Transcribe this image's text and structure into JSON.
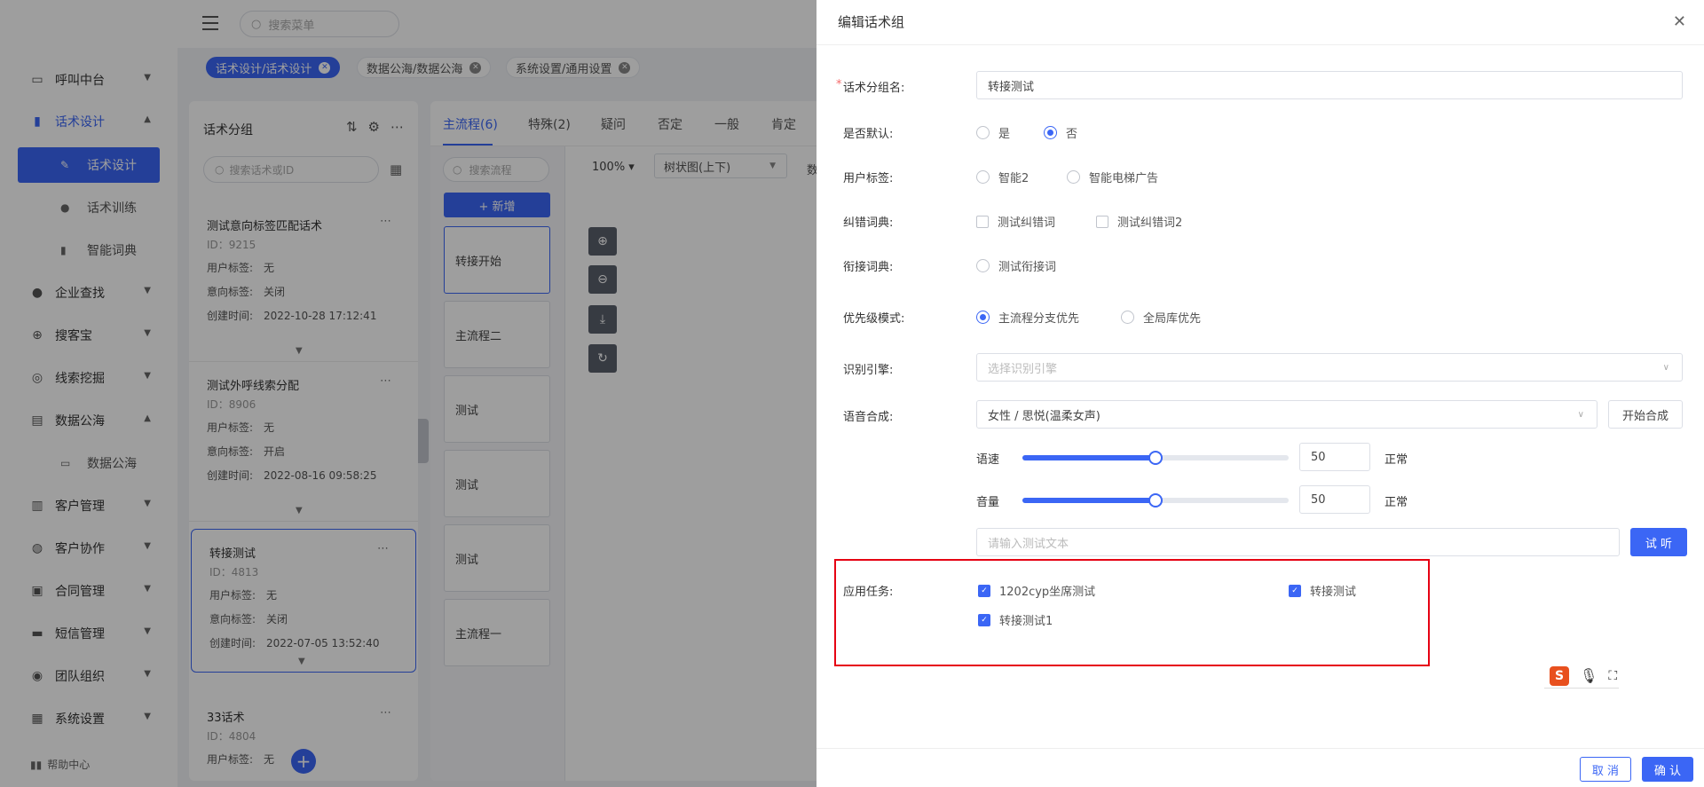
{
  "sidebar": {
    "items": [
      {
        "label": "呼叫中台",
        "icon": "monitor-icon"
      },
      {
        "label": "话术设计",
        "icon": "book-icon"
      },
      {
        "label": "企业查找",
        "icon": "bulb-icon"
      },
      {
        "label": "搜客宝",
        "icon": "search-plus-icon"
      },
      {
        "label": "线索挖掘",
        "icon": "target-icon"
      },
      {
        "label": "数据公海",
        "icon": "chart-icon"
      },
      {
        "label": "客户管理",
        "icon": "id-card-icon"
      },
      {
        "label": "客户协作",
        "icon": "globe-icon"
      },
      {
        "label": "合同管理",
        "icon": "clipboard-icon"
      },
      {
        "label": "短信管理",
        "icon": "message-icon"
      },
      {
        "label": "团队组织",
        "icon": "team-icon"
      },
      {
        "label": "系统设置",
        "icon": "grid-icon"
      }
    ],
    "sub_script": [
      "话术设计",
      "话术训练",
      "智能词典"
    ],
    "sub_data": [
      "数据公海"
    ],
    "help": "帮助中心"
  },
  "top": {
    "search_placeholder": "搜索菜单"
  },
  "tags": [
    {
      "label": "话术设计/话术设计"
    },
    {
      "label": "数据公海/数据公海"
    },
    {
      "label": "系统设置/通用设置"
    }
  ],
  "groups": {
    "title": "话术分组",
    "search_placeholder": "搜索话术或ID",
    "field_labels": {
      "user_tag": "用户标签:",
      "intent_tag": "意向标签:",
      "created": "创建时间:"
    },
    "cards": [
      {
        "name": "测试意向标签匹配话术",
        "id": "ID：9215",
        "user_tag": "无",
        "intent_tag": "关闭",
        "created": "2022-10-28 17:12:41"
      },
      {
        "name": "测试外呼线索分配",
        "id": "ID：8906",
        "user_tag": "无",
        "intent_tag": "开启",
        "created": "2022-08-16 09:58:25"
      },
      {
        "name": "转接测试",
        "id": "ID：4813",
        "user_tag": "无",
        "intent_tag": "关闭",
        "created": "2022-07-05 13:52:40"
      },
      {
        "name": "33话术",
        "id": "ID：4804",
        "user_tag": "无"
      }
    ]
  },
  "flow": {
    "tabs": [
      "主流程(6)",
      "特殊(2)",
      "疑问",
      "否定",
      "一般",
      "肯定"
    ],
    "search_placeholder": "搜索流程",
    "add_label": "+ 新增",
    "items": [
      "转接开始",
      "主流程二",
      "测试",
      "测试",
      "测试",
      "主流程一"
    ],
    "zoom": "100%",
    "layout": "树状图(上下)",
    "extra": "数"
  },
  "drawer": {
    "title": "编辑话术组",
    "name_label": "话术分组名:",
    "name_value": "转接测试",
    "default_label": "是否默认:",
    "default_options": [
      "是",
      "否"
    ],
    "user_tag_label": "用户标签:",
    "user_tag_options": [
      "智能2",
      "智能电梯广告"
    ],
    "correct_label": "纠错词典:",
    "correct_options": [
      "测试纠错词",
      "测试纠错词2"
    ],
    "connect_label": "衔接词典:",
    "connect_options": [
      "测试衔接词"
    ],
    "priority_label": "优先级模式:",
    "priority_options": [
      "主流程分支优先",
      "全局库优先"
    ],
    "engine_label": "识别引擎:",
    "engine_placeholder": "选择识别引擎",
    "tts_label": "语音合成:",
    "tts_value": "女性 / 思悦(温柔女声)",
    "tts_button": "开始合成",
    "speed_label": "语速",
    "speed_value": "50",
    "speed_text": "正常",
    "speed_level": 0.5,
    "volume_label": "音量",
    "volume_value": "50",
    "volume_text": "正常",
    "volume_level": 0.5,
    "test_placeholder": "请输入测试文本",
    "test_button": "试 听",
    "tasks_label": "应用任务:",
    "tasks": [
      "1202cyp坐席测试",
      "转接测试",
      "转接测试1"
    ],
    "cancel": "取 消",
    "confirm": "确 认"
  },
  "colors": {
    "accent": "#3b66f5",
    "highlight": "#e60012",
    "ime": "#e8501e"
  }
}
